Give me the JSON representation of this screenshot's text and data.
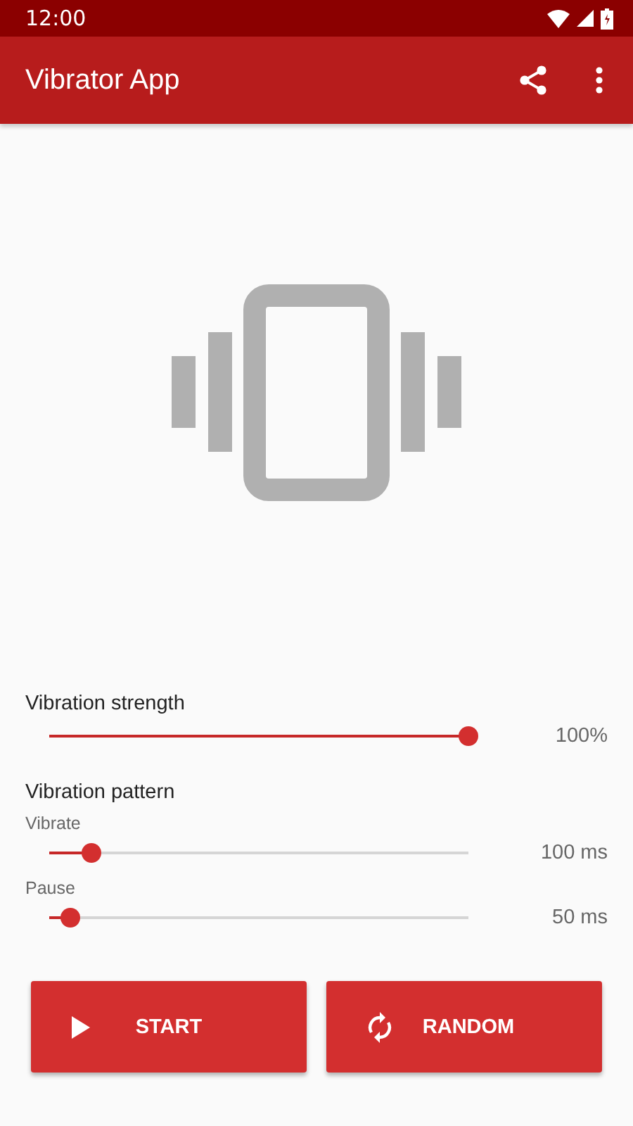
{
  "status_bar": {
    "time": "12:00"
  },
  "app_bar": {
    "title": "Vibrator App"
  },
  "strength": {
    "label": "Vibration strength",
    "level": 1.0,
    "reading": "100%"
  },
  "pattern": {
    "label": "Vibration pattern",
    "sliders": [
      {
        "label": "Vibrate",
        "level": 0.1,
        "reading": "100 ms"
      },
      {
        "label": "Pause",
        "level": 0.05,
        "reading": "50 ms"
      }
    ]
  },
  "buttons": [
    {
      "kind": "play",
      "label": "START"
    },
    {
      "kind": "shuffle",
      "label": "RANDOM"
    }
  ]
}
